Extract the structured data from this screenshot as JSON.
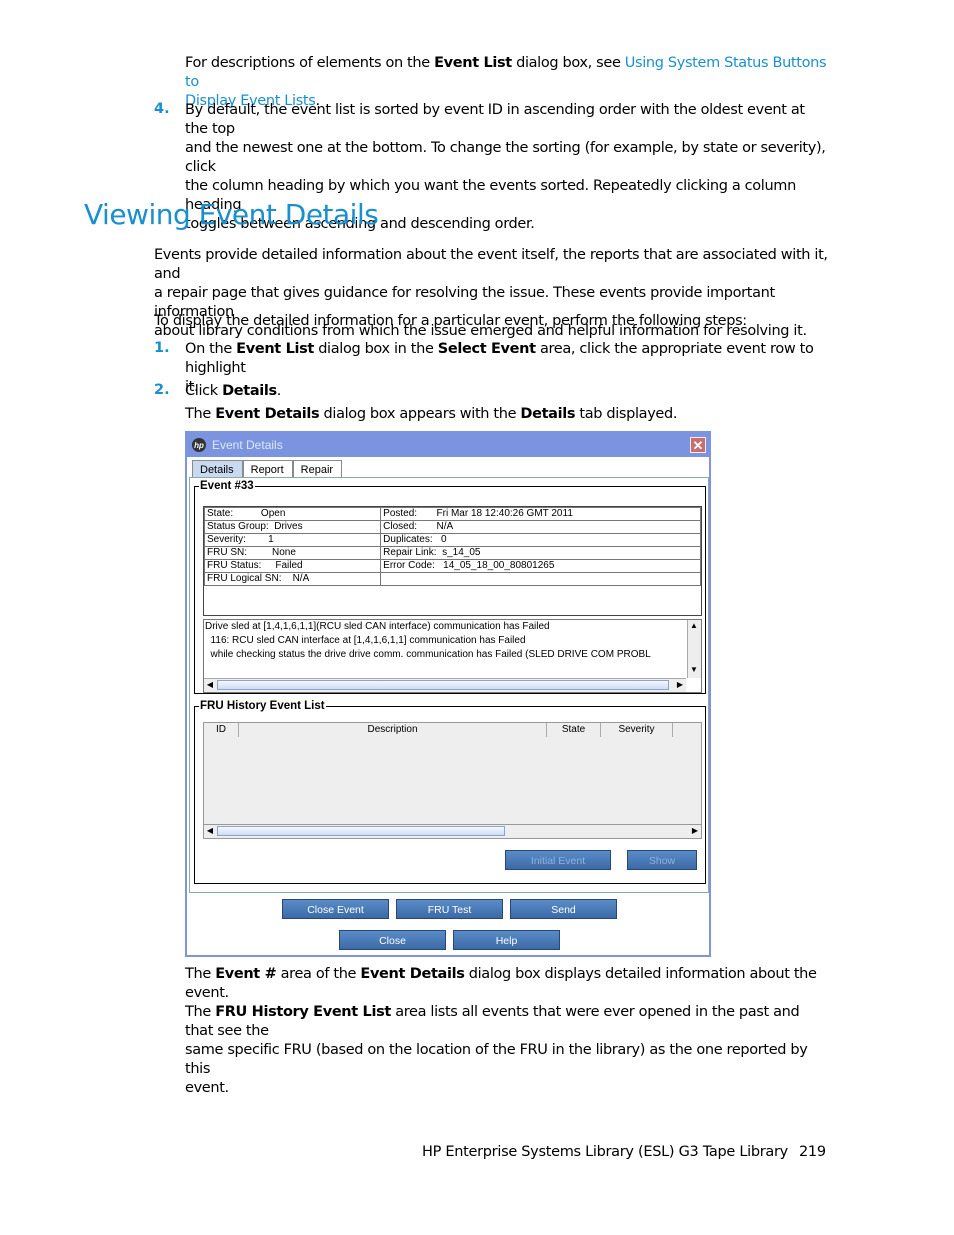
{
  "intro": {
    "pre": "For descriptions of elements on the ",
    "bold": "Event List",
    "mid": " dialog box, see ",
    "link_line1": "Using System Status Buttons to",
    "link_line2": "Display Event Lists",
    "post": "."
  },
  "step4": {
    "number": "4.",
    "lines": [
      "By default, the event list is sorted by event ID in ascending order with the oldest event at the top",
      "and the newest one at the bottom. To change the sorting (for example, by state or severity), click",
      "the column heading by which you want the events sorted. Repeatedly clicking a column heading",
      "toggles between ascending and descending order."
    ]
  },
  "section_title": "Viewing Event Details",
  "para1": [
    "Events provide detailed information about the event itself, the reports that are associated with it, and",
    "a repair page that gives guidance for resolving the issue. These events provide important information",
    "about library conditions from which the issue emerged and helpful information for resolving it."
  ],
  "para2": "To display the detailed information for a particular event, perform the following steps:",
  "step1": {
    "number": "1.",
    "t1": "On the ",
    "b1": "Event List",
    "t2": " dialog box in the ",
    "b2": "Select Event",
    "t3": " area, click the appropriate event row to highlight",
    "t4": "it."
  },
  "step2": {
    "number": "2.",
    "t1": "Click ",
    "b1": "Details",
    "t2": "."
  },
  "step2_note": {
    "t1": "The ",
    "b1": "Event Details",
    "t2": " dialog box appears with the ",
    "b2": "Details",
    "t3": " tab displayed."
  },
  "dialog": {
    "title": "Event Details",
    "logo": "hp",
    "close": "✕",
    "tabs": [
      "Details",
      "Report",
      "Repair"
    ],
    "event_legend": "Event #33",
    "fields_left": [
      "State:          Open",
      "Status Group:  Drives",
      "Severity:        1",
      "FRU SN:         None",
      "FRU Status:     Failed",
      "FRU Logical SN:    N/A"
    ],
    "fields_right": [
      "Posted:       Fri Mar 18 12:40:26 GMT 2011",
      "Closed:       N/A",
      "Duplicates:   0",
      "Repair Link:  s_14_05",
      "Error Code:   14_05_18_00_80801265",
      ""
    ],
    "message_lines": [
      "Drive sled at [1,4,1,6,1,1](RCU sled CAN interface) communication has Failed",
      "  116: RCU sled CAN interface at [1,4,1,6,1,1] communication has Failed",
      "  while checking status the drive drive comm. communication has Failed (SLED DRIVE COM PROBL"
    ],
    "history_legend": "FRU History Event List",
    "columns": [
      "ID",
      "Description",
      "State",
      "Severity"
    ],
    "history_buttons": [
      "Initial Event",
      "Show"
    ],
    "buttons_row1": [
      "Close Event",
      "FRU Test",
      "Send"
    ],
    "buttons_row2": [
      "Close",
      "Help"
    ]
  },
  "para3": {
    "l1a": "The ",
    "l1b": "Event #",
    "l1c": " area of the ",
    "l1d": "Event Details",
    "l1e": " dialog box displays detailed information about the event.",
    "l2a": "The ",
    "l2b": "FRU History Event List",
    "l2c": " area lists all events that were ever opened in the past and that see the",
    "l3": "same specific FRU (based on the location of the FRU in the library) as the one reported by this",
    "l4": "event."
  },
  "footer": {
    "title": "HP Enterprise Systems Library (ESL) G3 Tape Library",
    "page": "219"
  }
}
